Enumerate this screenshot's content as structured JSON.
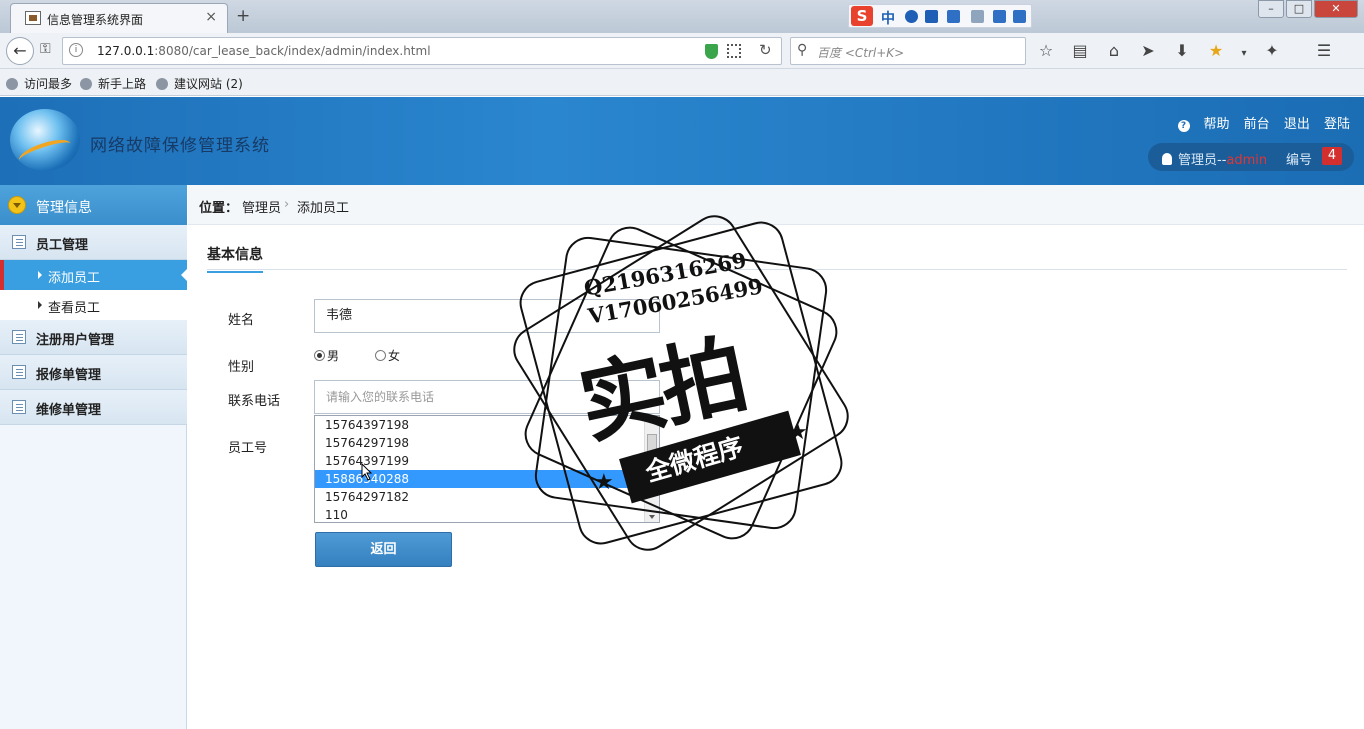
{
  "browser": {
    "tab_title": "信息管理系统界面",
    "tab_close": "×",
    "new_tab": "+",
    "url_host": "127.0.0.1",
    "url_rest": ":8080/car_lease_back/index/admin/index.html",
    "search_placeholder": "百度 <Ctrl+K>",
    "ime_mode": "中",
    "bookmarks": [
      "访问最多",
      "新手上路",
      "建议网站 (2)"
    ]
  },
  "header": {
    "app_name": "网络故障保修管理系统",
    "links": {
      "help": "帮助",
      "front": "前台",
      "logout": "退出",
      "login": "登陆"
    },
    "user_role": "管理员--",
    "user_name": "admin",
    "number_label": "编号",
    "number_value": "4"
  },
  "sidebar": {
    "title": "管理信息",
    "groups": [
      {
        "label": "员工管理",
        "items": [
          "添加员工",
          "查看员工"
        ]
      },
      {
        "label": "注册用户管理"
      },
      {
        "label": "报修单管理"
      },
      {
        "label": "维修单管理"
      }
    ]
  },
  "breadcrumb": {
    "label": "位置：",
    "crumb1": "管理员",
    "arrow": "›",
    "crumb2": "添加员工"
  },
  "form": {
    "section_title": "基本信息",
    "name_label": "姓名",
    "name_value": "韦德",
    "gender_label": "性别",
    "gender_male": "男",
    "gender_female": "女",
    "gender_selected": "男",
    "phone_label": "联系电话",
    "phone_placeholder": "请输入您的联系电话",
    "empno_label": "员工号",
    "autocomplete": [
      "15764397198",
      "15764297198",
      "15764397199",
      "15886340288",
      "15764297182",
      "110"
    ],
    "autocomplete_selected_index": 3,
    "back_button": "返回"
  },
  "watermark": {
    "line1": "Q2196316269",
    "line2": "V17060256499",
    "big": "实拍",
    "ribbon": "全微程序"
  }
}
